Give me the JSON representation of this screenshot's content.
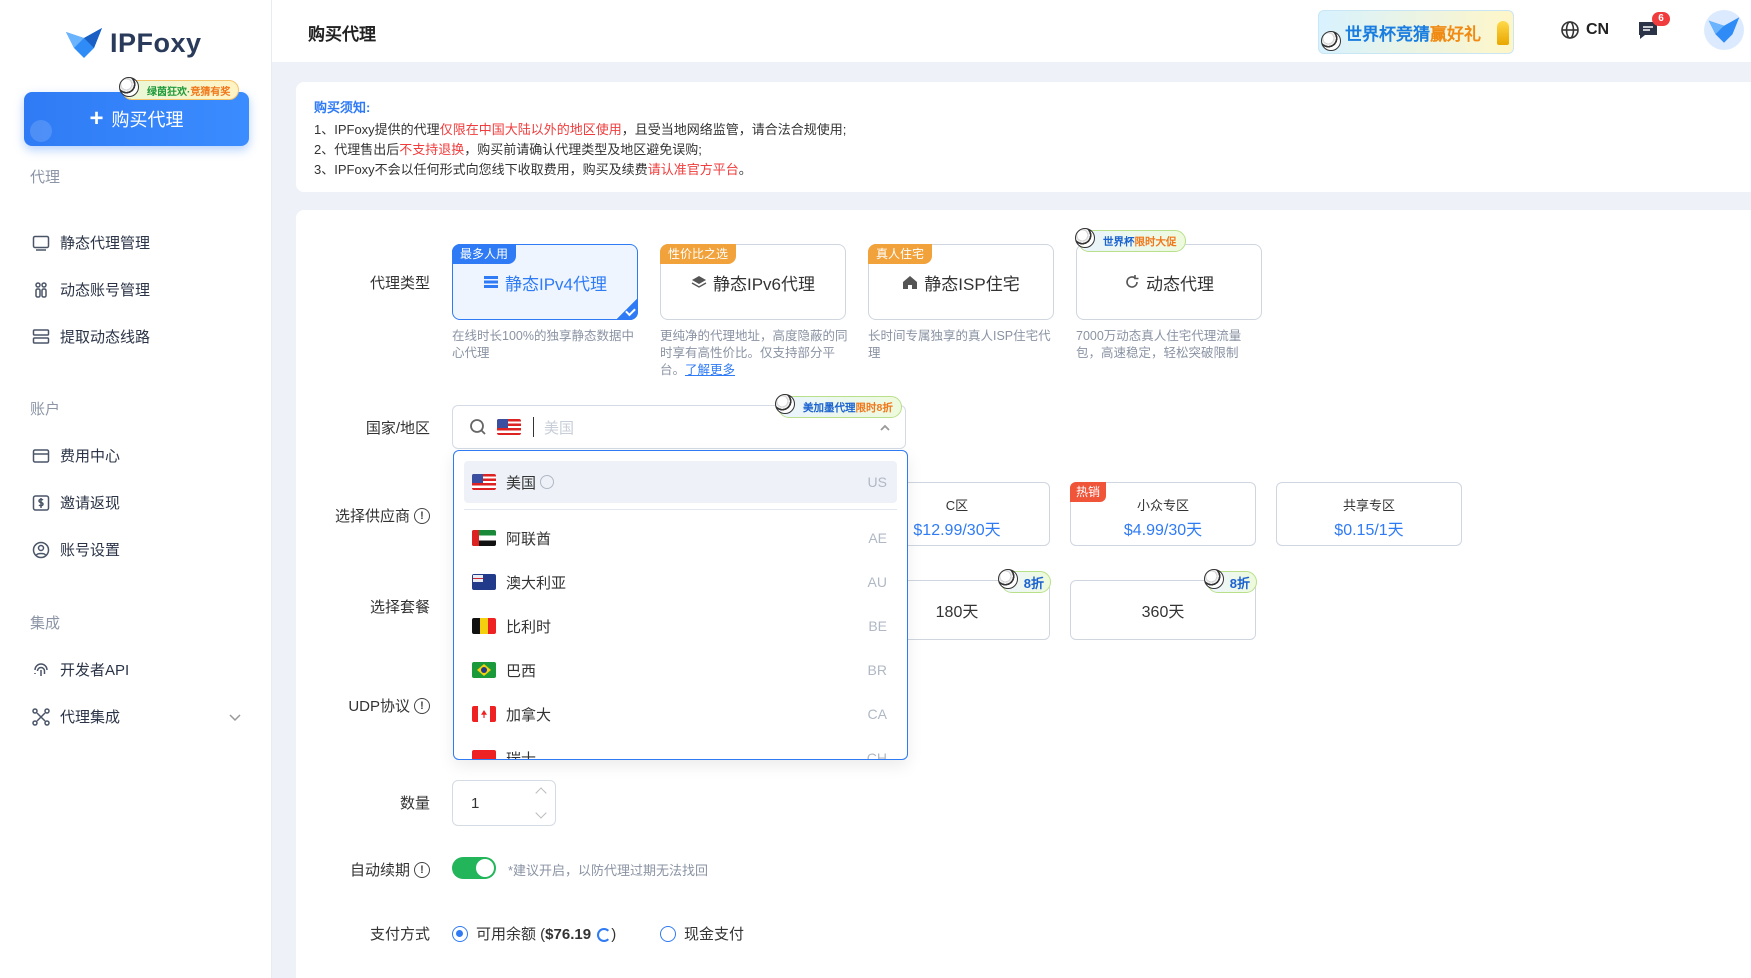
{
  "brand": {
    "name": "IPFoxy"
  },
  "sidebar": {
    "buy_button": "购买代理",
    "promo_tag": {
      "text": "绿茵狂欢·",
      "highlight": "竞猜有奖"
    },
    "sections": [
      {
        "title": "代理",
        "items": [
          {
            "label": "静态代理管理",
            "icon": "monitor-icon"
          },
          {
            "label": "动态账号管理",
            "icon": "users-icon"
          },
          {
            "label": "提取动态线路",
            "icon": "server-icon"
          }
        ]
      },
      {
        "title": "账户",
        "items": [
          {
            "label": "费用中心",
            "icon": "wallet-icon"
          },
          {
            "label": "邀请返现",
            "icon": "dollar-icon"
          },
          {
            "label": "账号设置",
            "icon": "user-circle-icon"
          }
        ]
      },
      {
        "title": "集成",
        "items": [
          {
            "label": "开发者API",
            "icon": "fingerprint-icon"
          },
          {
            "label": "代理集成",
            "icon": "network-icon"
          }
        ]
      }
    ]
  },
  "header": {
    "title": "购买代理",
    "banner": {
      "text": "世界杯竞猜",
      "highlight": "赢好礼"
    },
    "lang": "CN",
    "message_count": "6"
  },
  "notice": {
    "title": "购买须知:",
    "lines": [
      {
        "pre": "1、IPFoxy提供的代理",
        "red": "仅限在中国大陆以外的地区使用",
        "post": "，且受当地网络监管，请合法合规使用;"
      },
      {
        "pre": "2、代理售出后",
        "red": "不支持退换",
        "post": "，购买前请确认代理类型及地区避免误购;"
      },
      {
        "pre": "3、IPFoxy不会以任何形式向您线下收取费用，购买及续费",
        "red": "请认准官方平台",
        "post": "。"
      }
    ]
  },
  "form": {
    "labels": {
      "proxy_type": "代理类型",
      "country": "国家/地区",
      "provider": "选择供应商",
      "plan": "选择套餐",
      "udp": "UDP协议",
      "quantity": "数量",
      "auto_renew": "自动续期",
      "payment": "支付方式"
    },
    "proxy_types": [
      {
        "tag": "最多人用",
        "label": "静态IPv4代理",
        "desc": "在线时长100%的独享静态数据中心代理",
        "active": true
      },
      {
        "tag": "性价比之选",
        "label": "静态IPv6代理",
        "desc": "更纯净的代理地址，高度隐蔽的同时享有高性价比。仅支持部分平台。",
        "link": "了解更多"
      },
      {
        "tag": "真人住宅",
        "label": "静态ISP住宅",
        "desc": "长时间专属独享的真人ISP住宅代理"
      },
      {
        "tag": "",
        "label": "动态代理",
        "desc": "7000万动态真人住宅代理流量包，高速稳定，轻松突破限制"
      }
    ],
    "dynamic_ribbon": {
      "text": "世界杯",
      "highlight": "限时大促"
    },
    "country_ribbon": {
      "text": "美加墨代理",
      "highlight": "限时8折"
    },
    "country_selected_flag": "flag-us",
    "country_placeholder": "美国",
    "dropdown": [
      {
        "name": "美国",
        "code": "US",
        "flag": "flag-us",
        "selected": true
      },
      {
        "name": "阿联酋",
        "code": "AE",
        "flag": "flag-ae"
      },
      {
        "name": "澳大利亚",
        "code": "AU",
        "flag": "flag-au"
      },
      {
        "name": "比利时",
        "code": "BE",
        "flag": "flag-be"
      },
      {
        "name": "巴西",
        "code": "BR",
        "flag": "flag-br"
      },
      {
        "name": "加拿大",
        "code": "CA",
        "flag": "flag-ca"
      },
      {
        "name": "瑞士",
        "code": "CH",
        "flag": "flag-ch"
      }
    ],
    "providers": [
      {
        "name": "C区",
        "price": "$12.99/30天"
      },
      {
        "name": "小众专区",
        "price": "$4.99/30天",
        "hot": "热销"
      },
      {
        "name": "共享专区",
        "price": "$0.15/1天"
      }
    ],
    "plans": [
      {
        "label": "180天",
        "discount": "8折"
      },
      {
        "label": "360天",
        "discount": "8折"
      }
    ],
    "quantity": "1",
    "auto_renew_hint": "*建议开启，以防代理过期无法找回",
    "auto_renew_on": true,
    "payment": {
      "balance_label": "可用余额 (",
      "balance_value": "$76.19",
      "balance_end": ")",
      "cash_label": "现金支付"
    }
  }
}
